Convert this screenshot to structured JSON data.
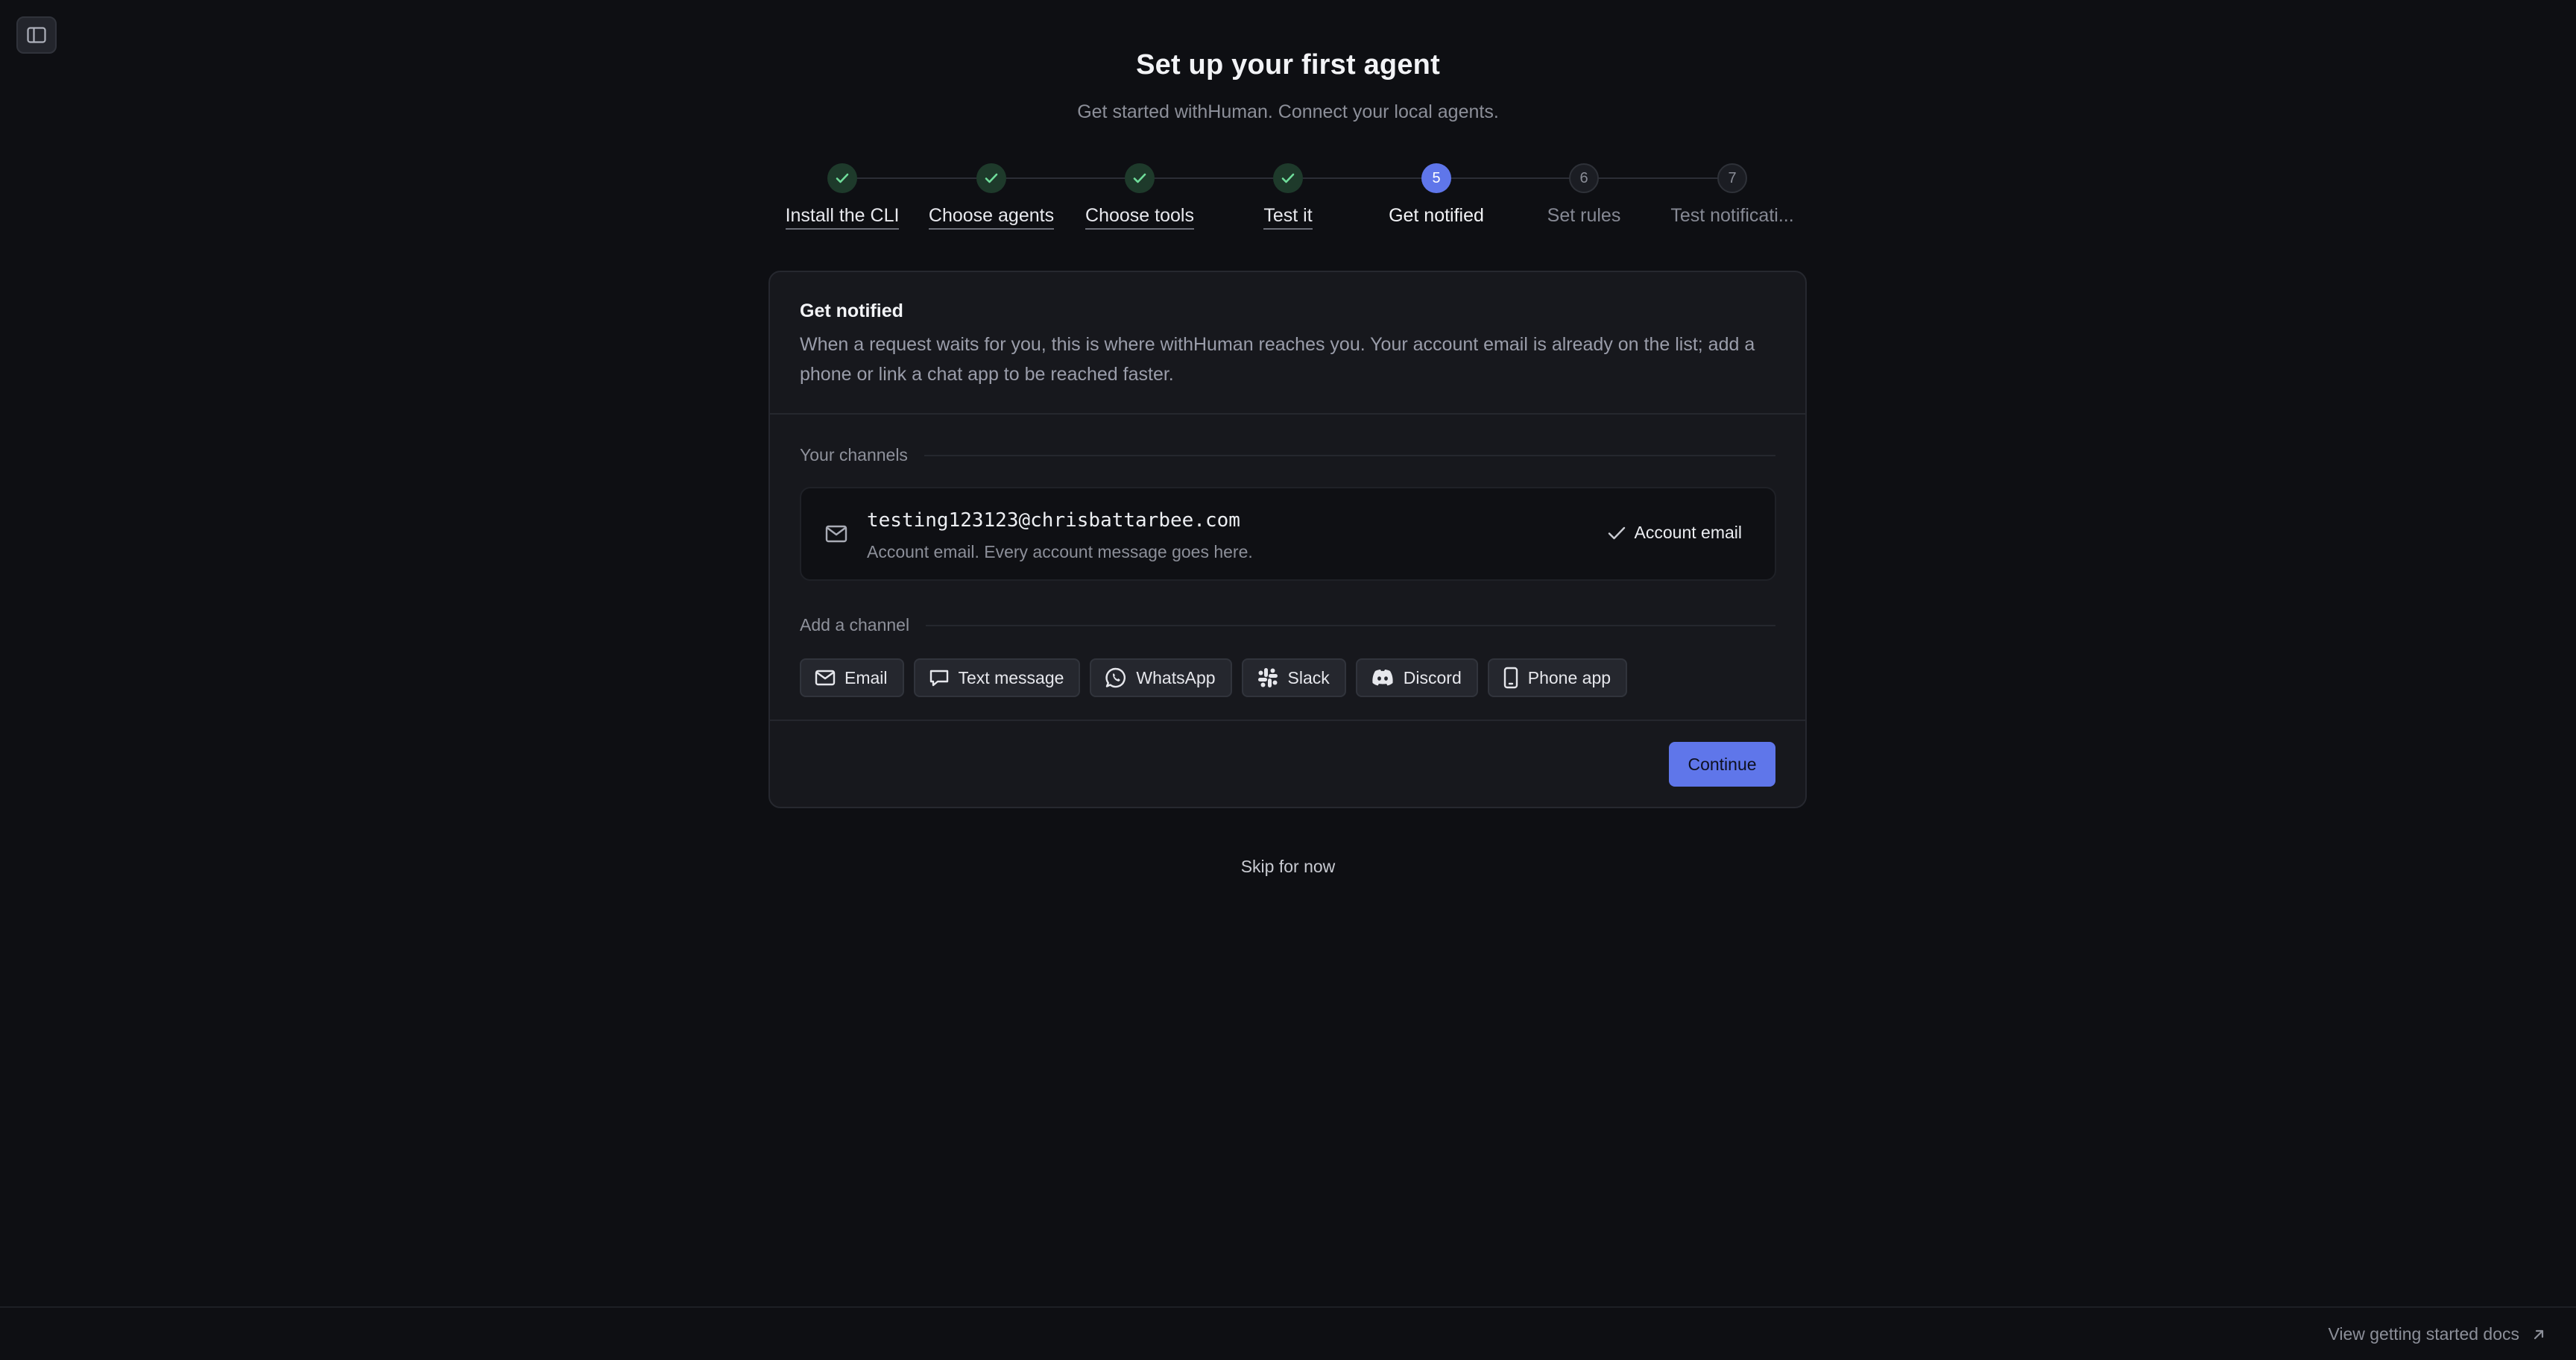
{
  "header": {
    "title": "Set up your first agent",
    "subtitle": "Get started withHuman. Connect your local agents."
  },
  "stepper": {
    "steps": [
      {
        "label": "Install the CLI",
        "state": "done"
      },
      {
        "label": "Choose agents",
        "state": "done"
      },
      {
        "label": "Choose tools",
        "state": "done"
      },
      {
        "label": "Test it",
        "state": "done"
      },
      {
        "label": "Get notified",
        "state": "current",
        "number": "5"
      },
      {
        "label": "Set rules",
        "state": "future",
        "number": "6"
      },
      {
        "label": "Test notificati...",
        "state": "future",
        "number": "7"
      }
    ]
  },
  "card": {
    "title": "Get notified",
    "description": "When a request waits for you, this is where withHuman reaches you. Your account email is already on the list; add a phone or link a chat app to be reached faster.",
    "channels_label": "Your channels",
    "channel": {
      "icon": "mail-icon",
      "email": "testing123123@chrisbattarbee.com",
      "description": "Account email. Every account message goes here.",
      "badge": "Account email"
    },
    "add_label": "Add a channel",
    "add_options": [
      {
        "label": "Email",
        "icon": "mail-icon"
      },
      {
        "label": "Text message",
        "icon": "message-icon"
      },
      {
        "label": "WhatsApp",
        "icon": "whatsapp-icon"
      },
      {
        "label": "Slack",
        "icon": "slack-icon"
      },
      {
        "label": "Discord",
        "icon": "discord-icon"
      },
      {
        "label": "Phone app",
        "icon": "phone-icon"
      }
    ],
    "continue_label": "Continue"
  },
  "skip_label": "Skip for now",
  "footer": {
    "docs_label": "View getting started docs"
  },
  "colors": {
    "background": "#0e0f13",
    "card": "#17181d",
    "accent": "#5f76ea",
    "done_dot": "#1e3a2b",
    "check": "#6fdc9a"
  }
}
